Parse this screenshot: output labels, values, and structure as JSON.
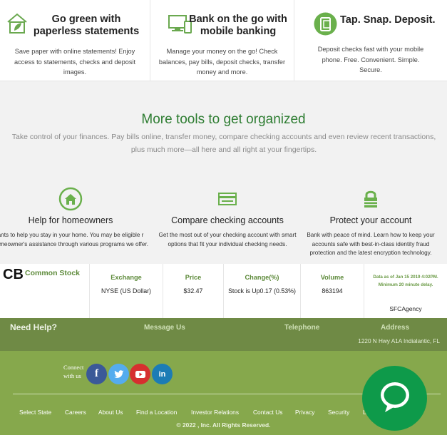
{
  "features": [
    {
      "title": "Go green with paperless statements",
      "desc": "Save paper with online statements! Enjoy access to statements, checks and deposit images.",
      "icon": "house-leaf-icon"
    },
    {
      "title": "Bank on the go with mobile banking",
      "desc": "Manage your money on the go! Check balances, pay bills, deposit checks, transfer money and more.",
      "icon": "devices-icon"
    },
    {
      "title": "Tap. Snap. Deposit.",
      "desc": "Deposit checks fast with your mobile phone. Free. Convenient. Simple. Secure.",
      "icon": "mobile-deposit-icon"
    }
  ],
  "tools": {
    "title": "More tools to get organized",
    "subtitle": "Take control of your finances. Pay bills online, transfer money, compare checking accounts and even review recent transactions, plus much more—all here and all right at your fingertips.",
    "items": [
      {
        "title": "Help for homeowners",
        "desc": "ants to help you stay in your home. You may be eligible r homeowner's assistance through various programs we offer.",
        "icon": "home-icon"
      },
      {
        "title": "Compare checking accounts",
        "desc": "Get the most out of your checking account with smart options that fit your individual checking needs.",
        "icon": "card-icon"
      },
      {
        "title": "Protect your account",
        "desc": "Bank with peace of mind. Learn how to keep your accounts safe with best-in-class identity fraud protection and the latest encryption technology.",
        "icon": "lock-icon"
      }
    ]
  },
  "stock": {
    "ticker": "CB",
    "label": "Common Stock",
    "exchange_label": "Exchange",
    "exchange_value": "NYSE (US Dollar)",
    "price_label": "Price",
    "price_value": "$32.47",
    "change_label": "Change(%)",
    "change_value": "Stock is Up0.17 (0.53%)",
    "volume_label": "Volume",
    "volume_value": "863194",
    "note": "Data as of Jan 15 2019 4:02PM. Minimum 20 minute delay.",
    "agency": "SFCAgency"
  },
  "help": {
    "title": "Need Help?",
    "message": "Message Us",
    "telephone": "Telephone",
    "address_label": "Address",
    "address": "1220 N Hwy A1A Indialantic, FL"
  },
  "footer": {
    "connect": "Connect with us",
    "social": [
      "facebook-icon",
      "twitter-icon",
      "youtube-icon",
      "linkedin-icon"
    ],
    "links": [
      "Select State",
      "Careers",
      "About Us",
      "Find a Location",
      "Investor Relations",
      "Contact Us",
      "Privacy",
      "Security",
      "L"
    ],
    "copyright": "© 2022 , Inc. All Rights Reserved."
  },
  "colors": {
    "green_text": "#2e7d32",
    "help_band": "#6f8a45",
    "footer": "#86a84c",
    "chat": "#0e9a4a",
    "facebook": "#3b5998",
    "twitter": "#55acee",
    "youtube": "#d62f2f",
    "linkedin": "#1c7cb5"
  }
}
